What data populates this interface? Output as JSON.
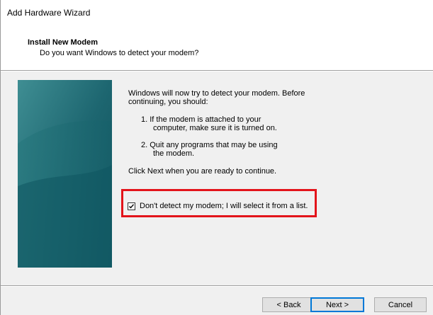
{
  "window": {
    "title": "Add Hardware Wizard"
  },
  "header": {
    "title": "Install New Modem",
    "subtitle": "Do you want Windows to detect your modem?"
  },
  "body": {
    "intro_line1": "Windows will now try to detect your modem.  Before",
    "intro_line2": "continuing, you should:",
    "step1_line1": "1.  If the modem is attached to your",
    "step1_line2": "computer, make sure it is turned on.",
    "step2_line1": "2.  Quit any programs that may be using",
    "step2_line2": "the modem.",
    "instruction": "Click Next when you are ready to continue."
  },
  "option": {
    "label": "Don't detect my modem; I will select it from a list.",
    "checked": true
  },
  "buttons": {
    "back": "< Back",
    "next": "Next >",
    "cancel": "Cancel"
  },
  "colors": {
    "highlight": "#e3141b",
    "banner_light": "#2e7d84",
    "banner_dark": "#0e4d57",
    "default_button_border": "#0078d7"
  }
}
